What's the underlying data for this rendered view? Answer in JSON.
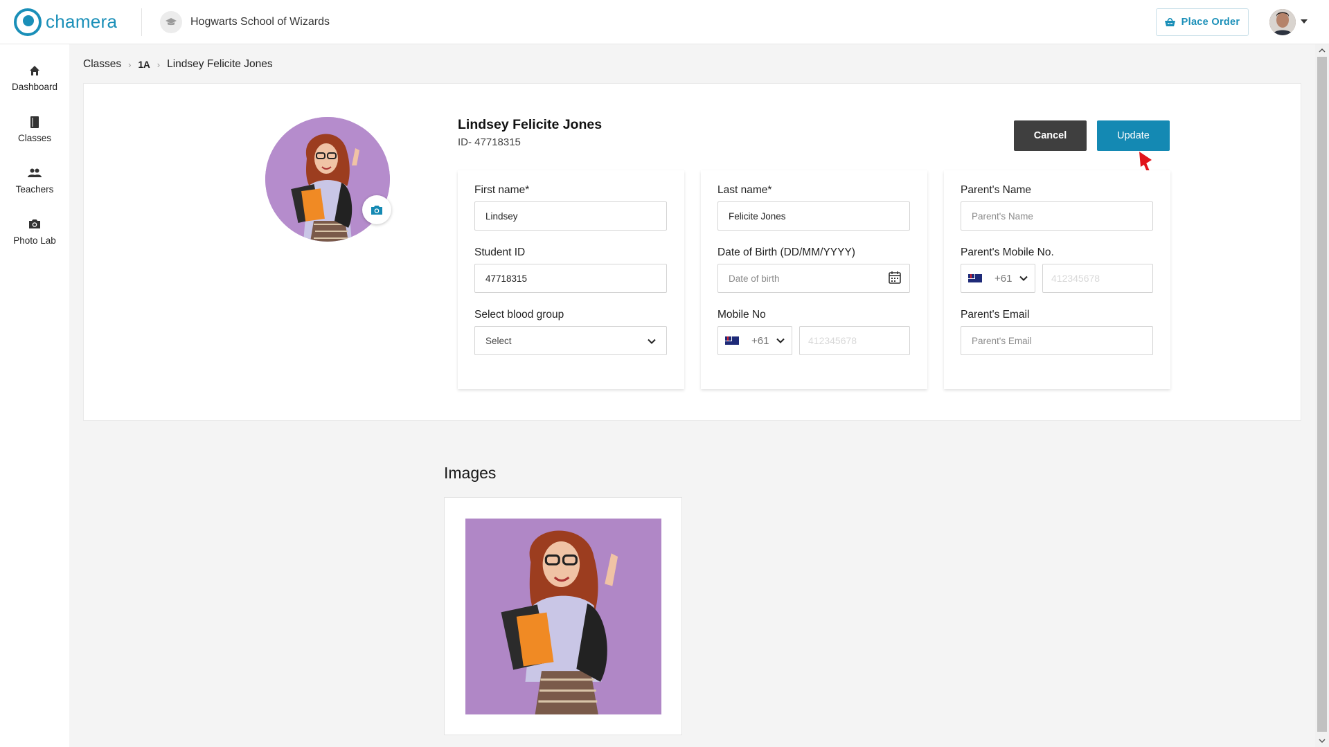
{
  "app": {
    "logo_text": "chamera",
    "school_name": "Hogwarts School of Wizards",
    "place_order_label": "Place Order"
  },
  "sidebar": {
    "items": [
      {
        "label": "Dashboard",
        "icon": "home-icon"
      },
      {
        "label": "Classes",
        "icon": "book-icon"
      },
      {
        "label": "Teachers",
        "icon": "people-icon"
      },
      {
        "label": "Photo Lab",
        "icon": "camera-icon"
      }
    ]
  },
  "breadcrumb": {
    "root": "Classes",
    "class": "1A",
    "student": "Lindsey Felicite Jones"
  },
  "profile": {
    "name": "Lindsey Felicite Jones",
    "id_text": "ID- 47718315",
    "cancel_label": "Cancel",
    "update_label": "Update"
  },
  "form": {
    "first_name": {
      "label": "First name*",
      "value": "Lindsey"
    },
    "student_id": {
      "label": "Student ID",
      "value": "47718315"
    },
    "blood_group": {
      "label": "Select blood group",
      "value": "Select"
    },
    "last_name": {
      "label": "Last name*",
      "value": "Felicite Jones"
    },
    "dob": {
      "label": "Date of Birth (DD/MM/YYYY)",
      "placeholder": "Date of birth"
    },
    "mobile": {
      "label": "Mobile No",
      "code": "+61",
      "placeholder": "412345678"
    },
    "parent_name": {
      "label": "Parent's Name",
      "placeholder": "Parent's Name"
    },
    "parent_mobile": {
      "label": "Parent's Mobile No.",
      "code": "+61",
      "placeholder": "412345678"
    },
    "parent_email": {
      "label": "Parent's Email",
      "placeholder": "Parent's Email"
    }
  },
  "images": {
    "title": "Images"
  },
  "colors": {
    "brand": "#1a8fb8",
    "update_button": "#1489b3",
    "cancel_button": "#3f3f3f",
    "photo_background": "#b58ccc"
  }
}
